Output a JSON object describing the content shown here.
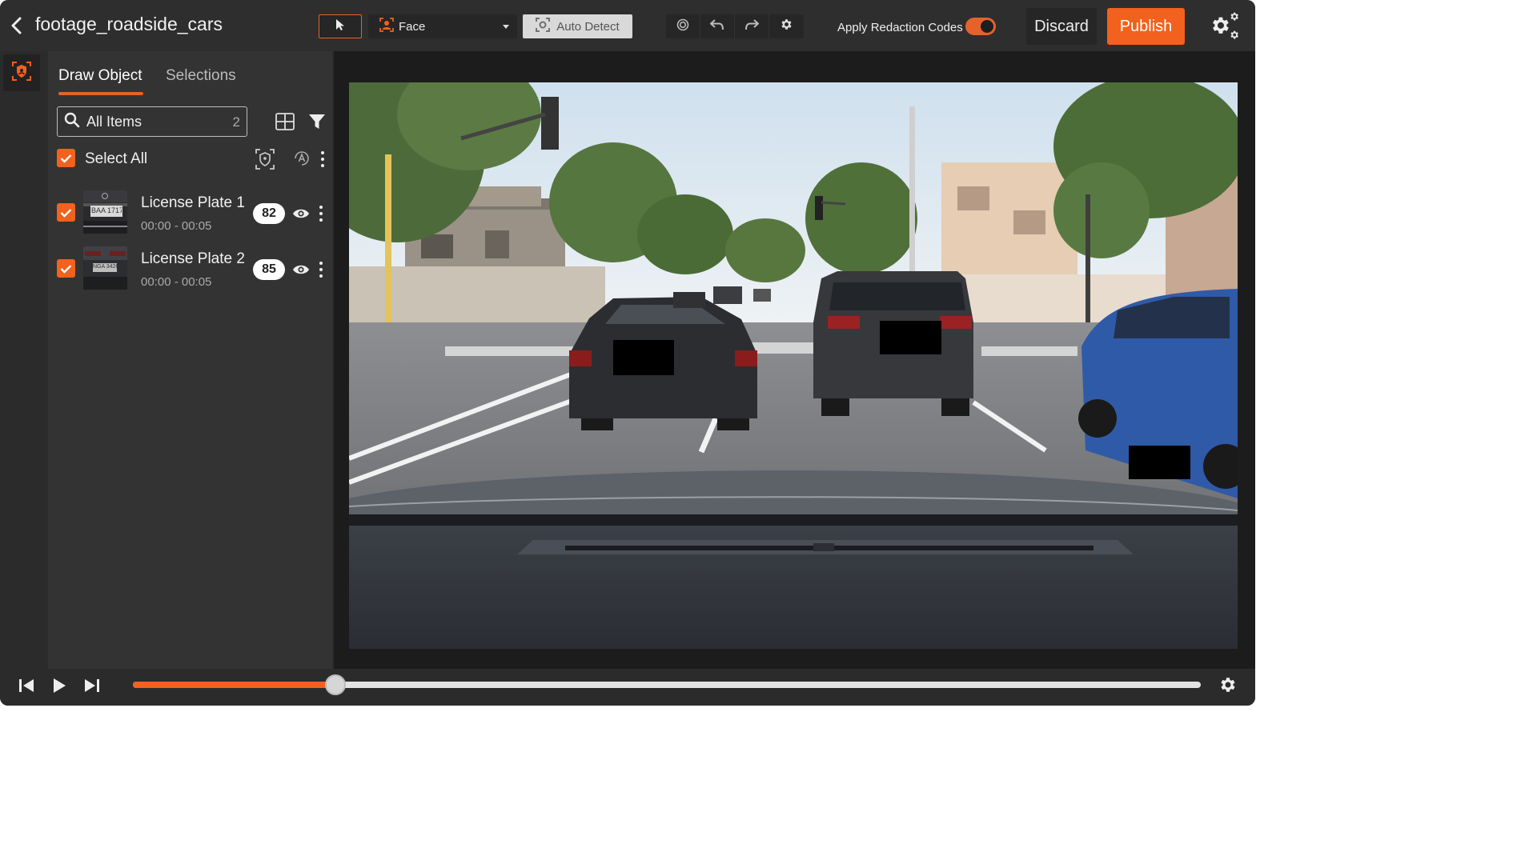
{
  "header": {
    "file_title": "footage_roadside_cars",
    "mode_label": "Face",
    "auto_detect_label": "Auto Detect",
    "apply_redaction_label": "Apply Redaction Codes",
    "apply_redaction_on": true,
    "discard_label": "Discard",
    "publish_label": "Publish"
  },
  "panel": {
    "tabs": [
      {
        "label": "Draw Object",
        "active": true
      },
      {
        "label": "Selections",
        "active": false
      }
    ],
    "search": {
      "placeholder": "All Items",
      "count": "2"
    },
    "select_all_label": "Select All",
    "items": [
      {
        "title": "License Plate 1",
        "time": "00:00 - 00:05",
        "score": "82",
        "plate_text": "BAA 1717",
        "checked": true
      },
      {
        "title": "License Plate 2",
        "time": "00:00 - 00:05",
        "score": "85",
        "plate_text": "NGA 3426",
        "checked": true
      }
    ]
  },
  "player": {
    "progress": 0.19
  },
  "colors": {
    "accent": "#f2611d",
    "background": "#2c2c2c",
    "panel": "#333333"
  },
  "icons": [
    "back-arrow-icon",
    "pointer-icon",
    "face-icon",
    "scan-icon",
    "target-icon",
    "undo-icon",
    "redo-icon",
    "gear-icon",
    "settings-gears-icon",
    "shield-face-icon",
    "search-icon",
    "grid-icon",
    "filter-icon",
    "auto-redact-icon",
    "eye-icon",
    "step-back-icon",
    "play-icon",
    "step-forward-icon"
  ]
}
